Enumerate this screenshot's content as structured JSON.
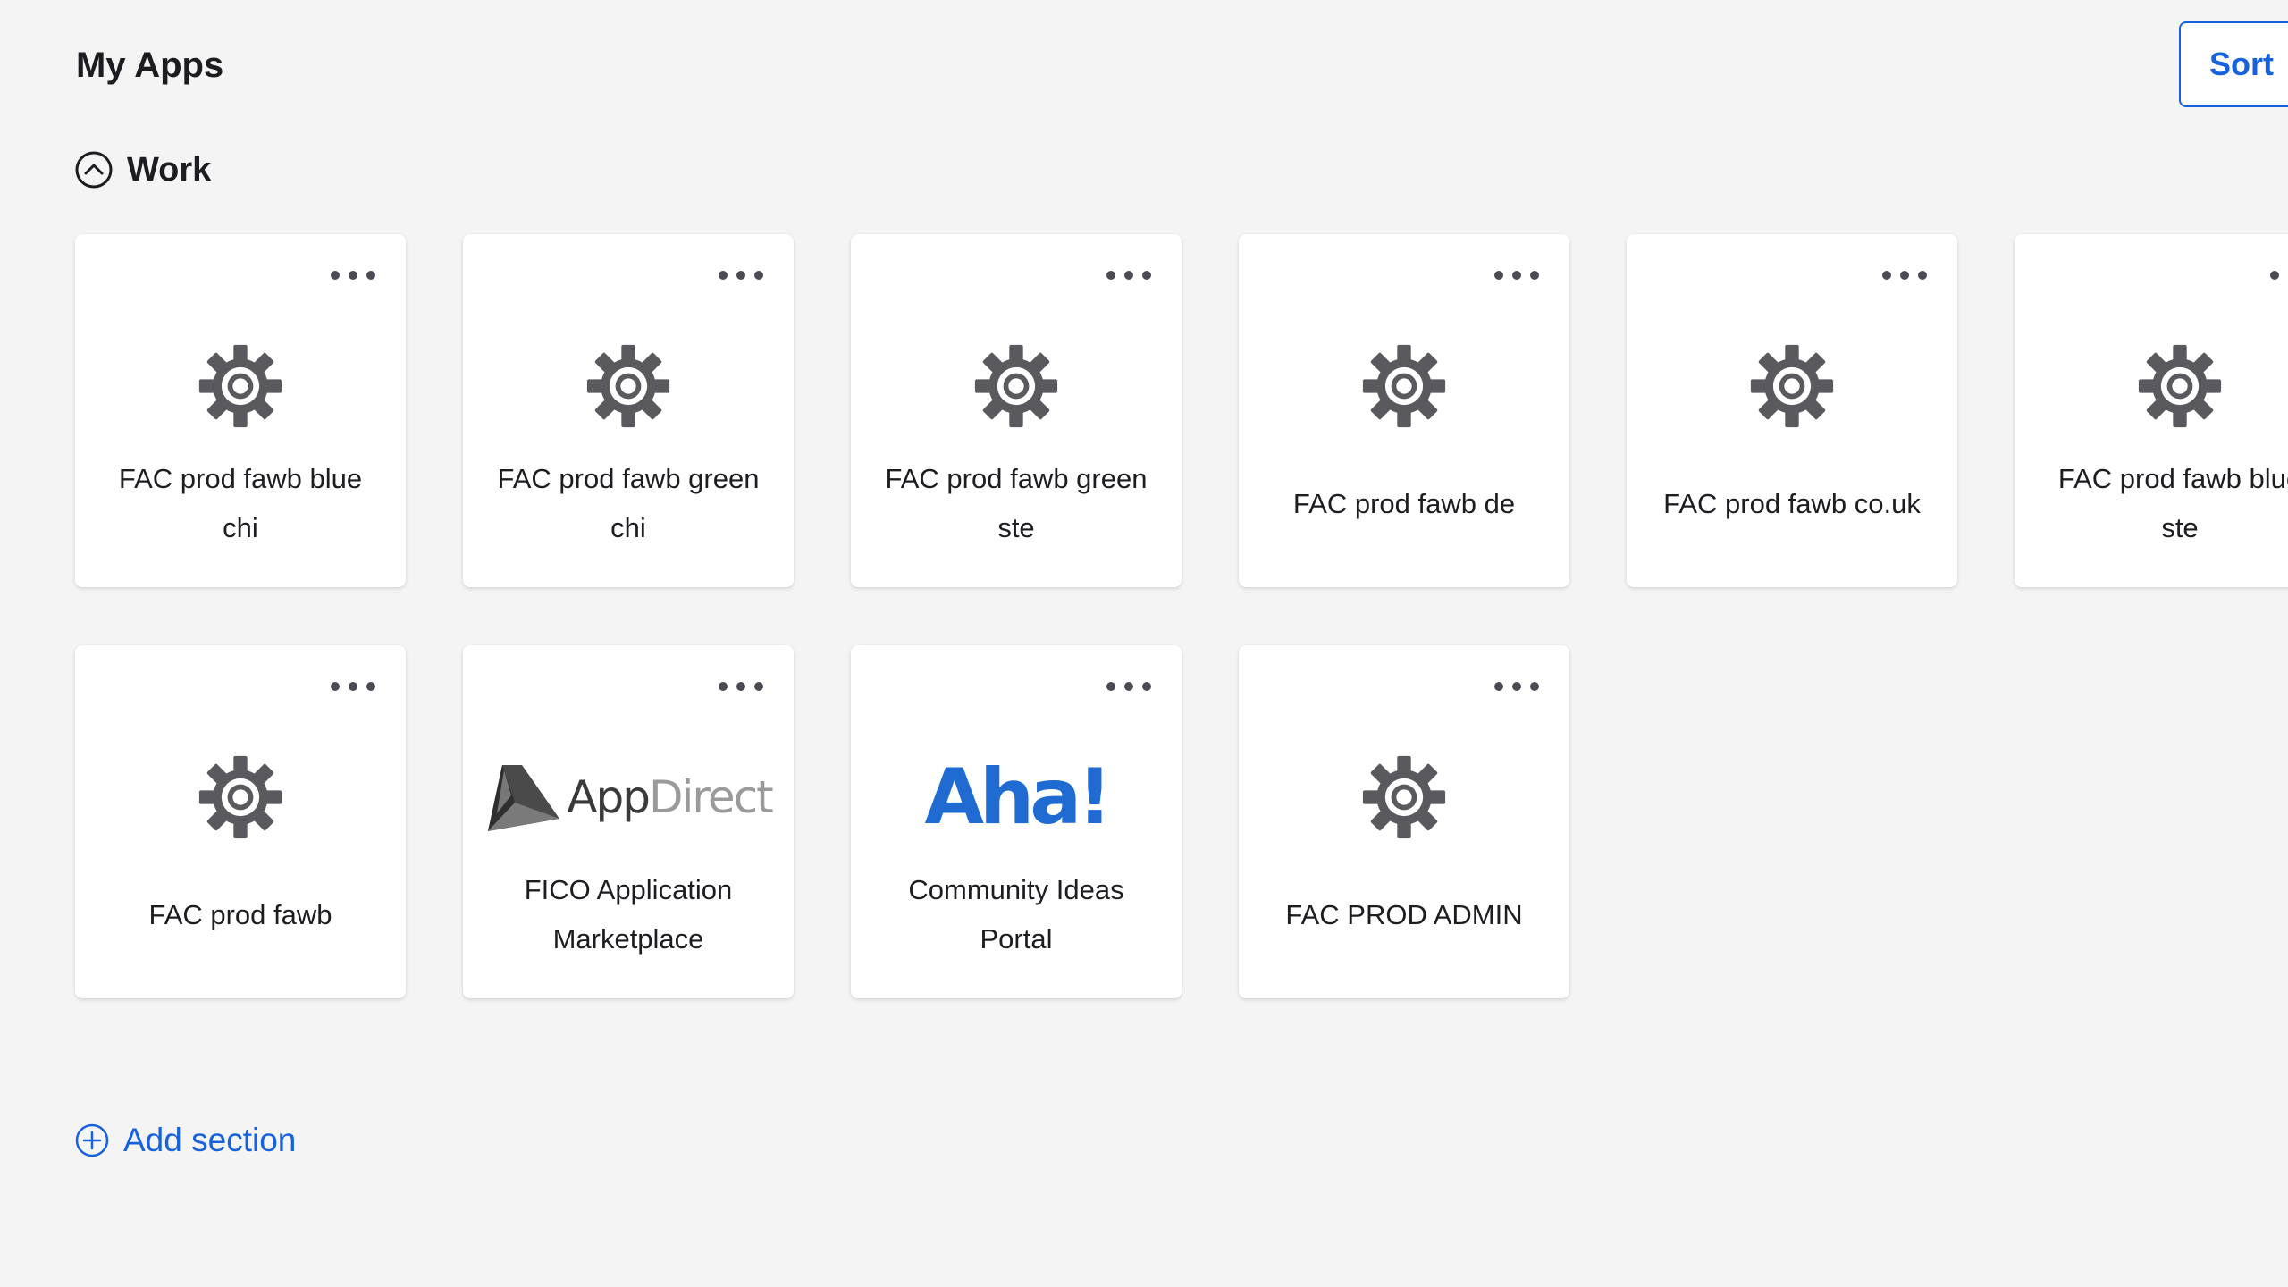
{
  "page": {
    "title": "My Apps",
    "sort_label": "Sort"
  },
  "section": {
    "title": "Work",
    "toggle_icon": "chevron-up-circle-icon",
    "tiles": [
      {
        "name": "FAC prod fawb blue chi",
        "logo": "gear-icon"
      },
      {
        "name": "FAC prod fawb green chi",
        "logo": "gear-icon"
      },
      {
        "name": "FAC prod fawb green ste",
        "logo": "gear-icon"
      },
      {
        "name": "FAC prod fawb de",
        "logo": "gear-icon"
      },
      {
        "name": "FAC prod fawb co.uk",
        "logo": "gear-icon"
      },
      {
        "name": "FAC prod fawb blue ste",
        "logo": "gear-icon"
      },
      {
        "name": "FAC prod fawb",
        "logo": "gear-icon"
      },
      {
        "name": "FICO Application Marketplace",
        "logo": "appdirect-logo",
        "logo_text_app": "App",
        "logo_text_direct": "Direct"
      },
      {
        "name": "Community Ideas Portal",
        "logo": "aha-logo",
        "logo_text": "Aha!"
      },
      {
        "name": "FAC PROD ADMIN",
        "logo": "gear-icon"
      }
    ]
  },
  "add_section": {
    "label": "Add section",
    "icon": "plus-circle-icon"
  },
  "colors": {
    "background": "#f4f4f4",
    "accent": "#1662dd",
    "text": "#1d1d21",
    "gear": "#5a5a5e",
    "aha_blue": "#1f6bd2"
  }
}
